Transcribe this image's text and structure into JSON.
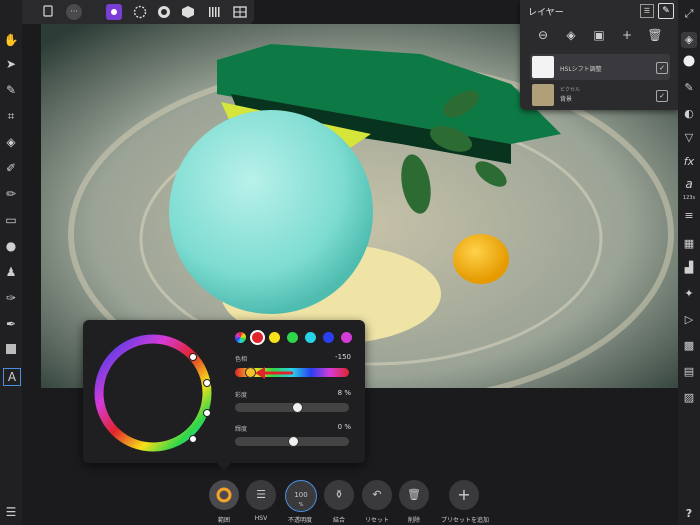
{
  "colors": {
    "app_bg": "#1b1b1d",
    "panel_bg": "#2b2b2e",
    "accent_red": "#e0242c",
    "accent_purple": "#7a3dd6"
  },
  "top_toolbar": {
    "icons": [
      "document-icon",
      "more-icon",
      "photo-persona-icon",
      "liquify-persona-icon",
      "develop-persona-icon",
      "tone-mapping-persona-icon",
      "export-persona-icon",
      "grid-icon"
    ],
    "more_label": "···"
  },
  "left_toolbar": {
    "icons": [
      "hand-icon",
      "move-icon",
      "color-picker-icon",
      "crop-icon",
      "fill-icon",
      "selection-brush-icon",
      "paint-brush-icon",
      "eraser-icon",
      "dodge-icon",
      "clone-icon",
      "inpaint-icon",
      "blemish-icon",
      "rectangle-icon",
      "text-icon",
      "settings-icon"
    ]
  },
  "right_toolbar": {
    "icons": [
      "expand-icon",
      "layers-icon",
      "color-icon",
      "brush-icon",
      "adjustment-icon",
      "navigator-icon",
      "history-icon",
      "fx-icon",
      "glyph-icon",
      "stock-icon",
      "channels-icon",
      "histogram-icon",
      "transform-icon",
      "play-icon",
      "swatches-icon",
      "macro-icon",
      "info-icon",
      "help-icon"
    ],
    "glyph_label": "a",
    "glyph_sub": "123s",
    "fx_label": "fx",
    "help_label": "?"
  },
  "layers_panel": {
    "title": "レイヤー",
    "buttons": [
      "layer-options-icon",
      "stack-icon",
      "mask-icon",
      "add-layer-icon",
      "delete-layer-icon"
    ],
    "plus_label": "+",
    "layers": [
      {
        "name": "HSLシフト調整",
        "kind": "",
        "checked": true
      },
      {
        "name": "背景",
        "kind": "ピクセル",
        "checked": true
      }
    ]
  },
  "hsl_popup": {
    "swatch_colors": [
      "rainbow",
      "#e0242c",
      "#f7e11a",
      "#2fd64a",
      "#27d3e8",
      "#2a3ff0",
      "#d53bd8"
    ],
    "hue": {
      "label": "色相",
      "value": "-150"
    },
    "saturation": {
      "label": "彩度",
      "value": "8 %",
      "level": 0.54
    },
    "luminosity": {
      "label": "輝度",
      "value": "0 %",
      "level": 0.5
    }
  },
  "bottom_bar": {
    "items": [
      {
        "label": "範囲",
        "icon": "range-wheel-icon"
      },
      {
        "label": "HSV",
        "icon": "sliders-icon"
      },
      {
        "label": "不透明度",
        "icon": "opacity-dial-icon",
        "value": "100",
        "unit": "%"
      },
      {
        "label": "結合",
        "icon": "merge-icon"
      },
      {
        "label": "リセット",
        "icon": "reset-icon"
      },
      {
        "label": "削除",
        "icon": "trash-icon"
      },
      {
        "label": "プリセットを追加",
        "icon": "add-preset-icon",
        "glyph": "+"
      }
    ]
  }
}
